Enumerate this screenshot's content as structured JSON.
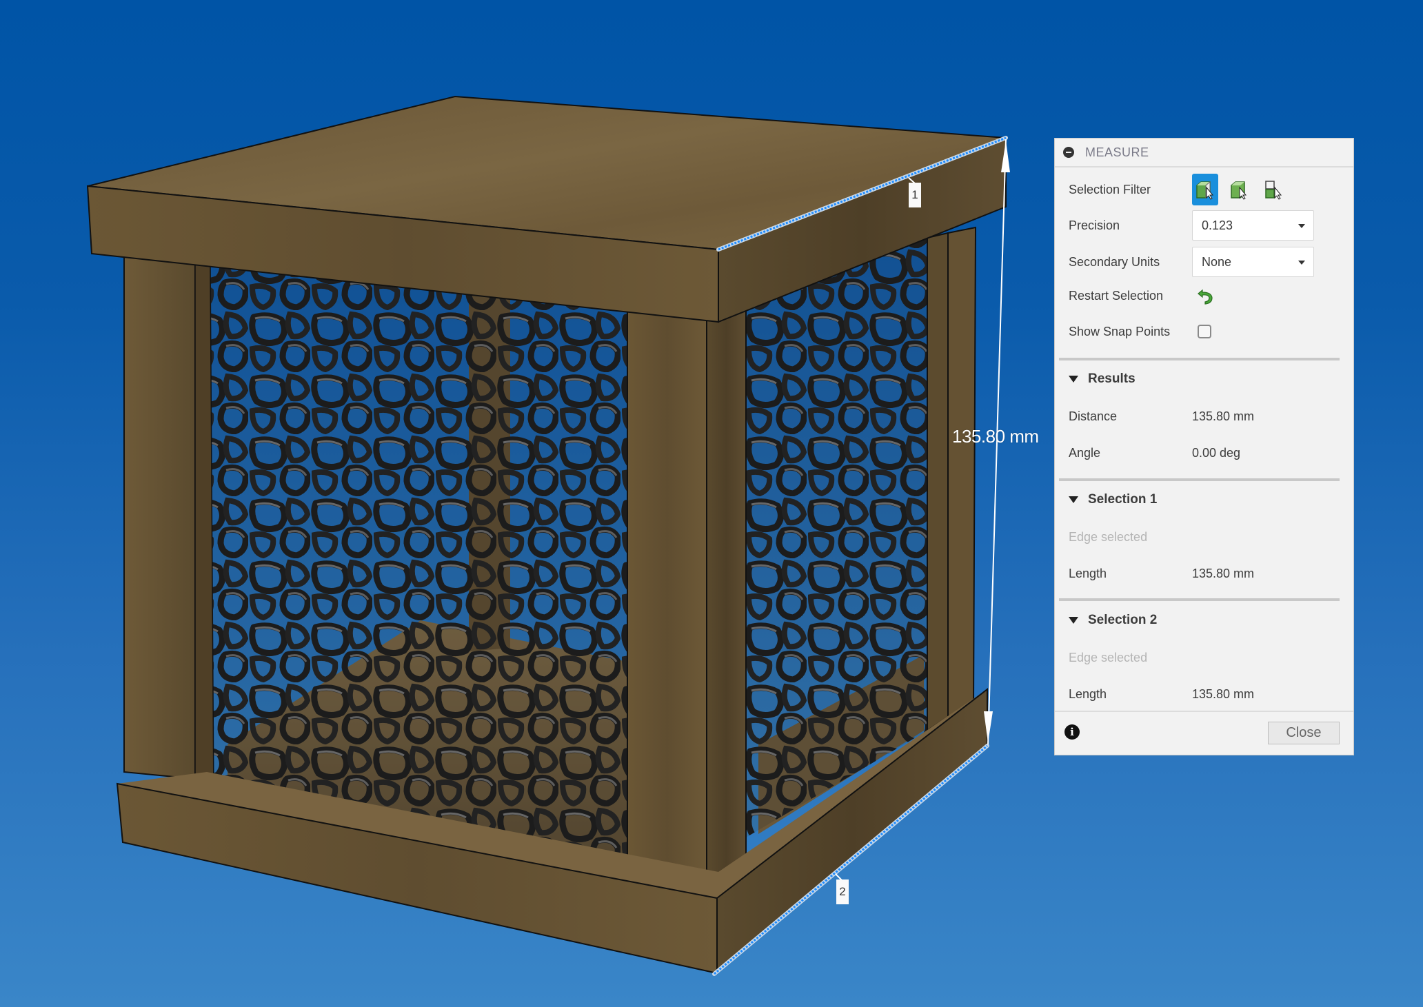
{
  "viewport": {
    "dimension_label": "135.80 mm",
    "edge_tags": [
      "1",
      "2"
    ],
    "colors": {
      "selected_edge": "#1e8cff",
      "wood": "#6e5a3a",
      "lattice": "#2a2a2a"
    }
  },
  "measure_panel": {
    "title": "MEASURE",
    "selection_filter": {
      "label": "Selection Filter",
      "options": [
        {
          "icon": "select-body-icon",
          "active": true
        },
        {
          "icon": "select-face-icon",
          "active": false
        },
        {
          "icon": "select-component-icon",
          "active": false
        }
      ]
    },
    "precision": {
      "label": "Precision",
      "value": "0.123"
    },
    "secondary_units": {
      "label": "Secondary Units",
      "value": "None"
    },
    "restart_selection": {
      "label": "Restart Selection",
      "icon": "restart-arrow-icon"
    },
    "show_snap_points": {
      "label": "Show Snap Points",
      "checked": false
    },
    "results": {
      "header": "Results",
      "distance": {
        "label": "Distance",
        "value": "135.80 mm"
      },
      "angle": {
        "label": "Angle",
        "value": "0.00 deg"
      }
    },
    "selection1": {
      "header": "Selection 1",
      "status": "Edge selected",
      "length": {
        "label": "Length",
        "value": "135.80 mm"
      }
    },
    "selection2": {
      "header": "Selection 2",
      "status": "Edge selected",
      "length": {
        "label": "Length",
        "value": "135.80 mm"
      }
    },
    "footer": {
      "info_icon": "info-icon",
      "close_label": "Close"
    }
  }
}
